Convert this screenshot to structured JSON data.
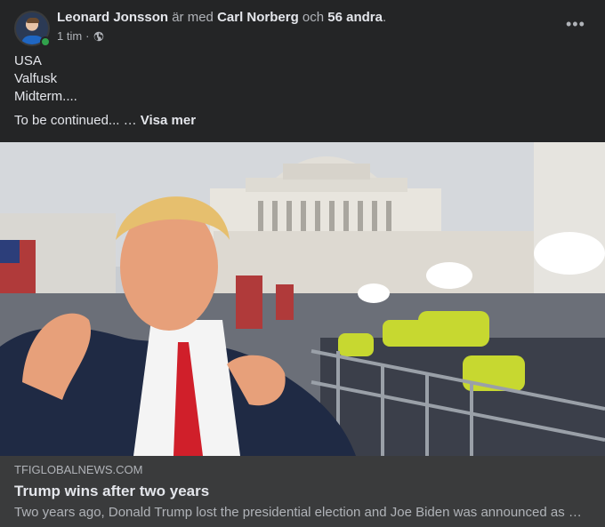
{
  "post": {
    "author": "Leonard Jonsson",
    "with_text": "är med",
    "tagged": "Carl Norberg",
    "and_text": "och",
    "others": "56 andra",
    "period": ".",
    "time": "1 tim",
    "separator": "·",
    "lines": [
      "USA",
      "Valfusk",
      "Midterm...."
    ],
    "continued": "To be continued... …",
    "see_more": "Visa mer",
    "more_icon": "•••"
  },
  "link": {
    "domain": "TFIGLOBALNEWS.COM",
    "title": "Trump wins after two years",
    "description": "Two years ago, Donald Trump lost the presidential election and Joe Biden was announced as the winner of the election."
  },
  "colors": {
    "card": "#242526",
    "preview": "#3a3b3c",
    "text": "#e4e6eb",
    "muted": "#b0b3b8",
    "online": "#31a24c"
  }
}
